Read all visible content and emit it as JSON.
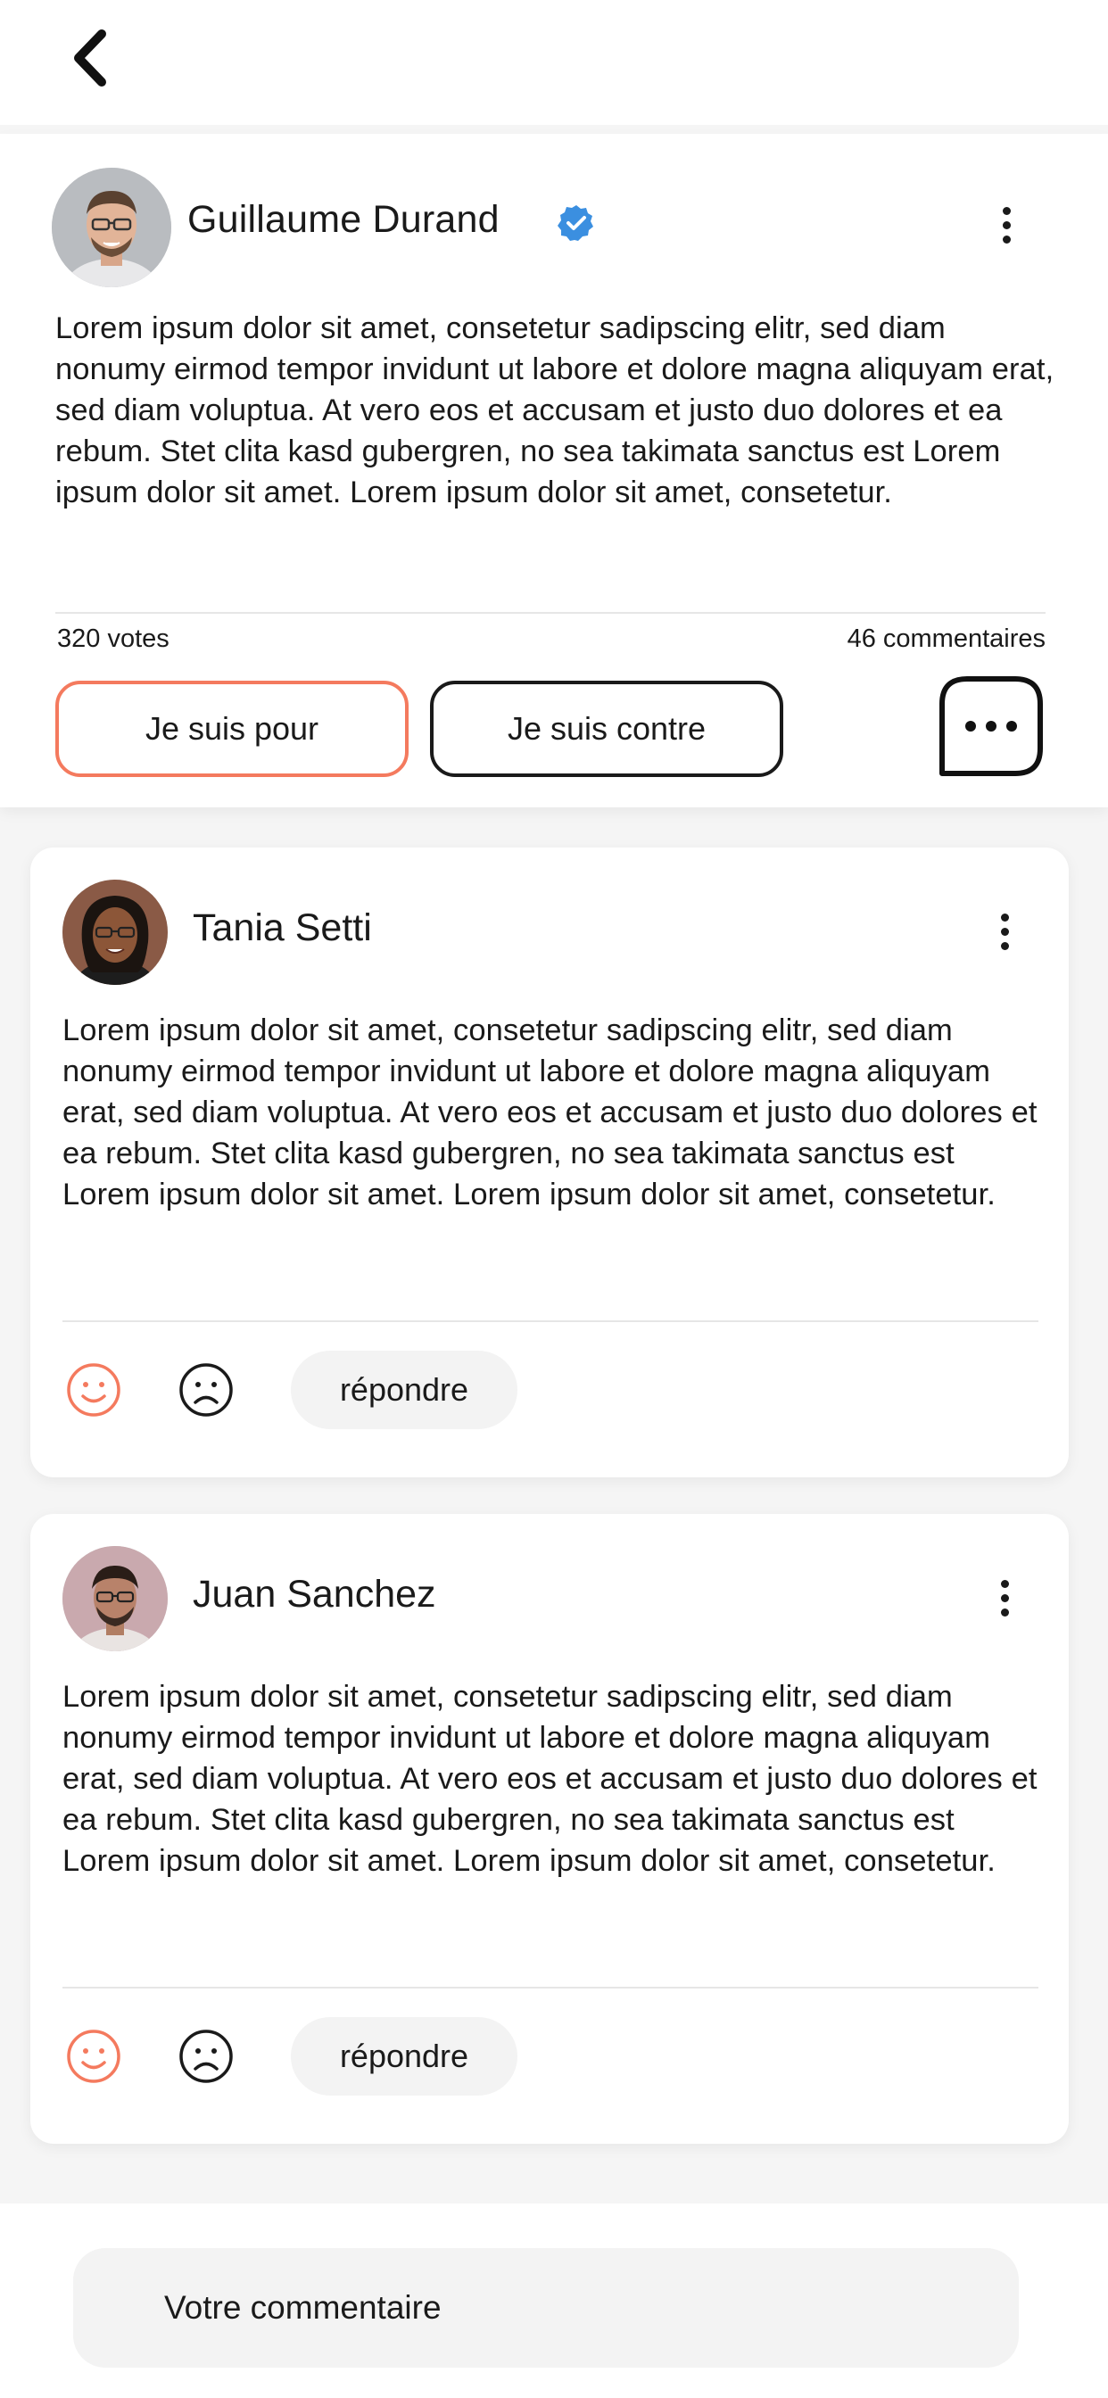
{
  "post": {
    "author": "Guillaume Durand",
    "verified": true,
    "text": "Lorem ipsum dolor sit amet, consetetur sadipscing elitr, sed diam nonumy eirmod tempor invidunt ut labore et dolore magna aliquyam erat, sed diam voluptua. At vero eos et accusam et justo duo dolores et ea rebum. Stet clita kasd gubergren, no sea takimata sanctus est Lorem ipsum dolor sit amet. Lorem ipsum dolor sit amet, consetetur.",
    "votes": "320 votes",
    "comments_count": "46 commentaires",
    "pour_label": "Je suis pour",
    "contre_label": "Je suis contre"
  },
  "comments": [
    {
      "author": "Tania Setti",
      "text": "Lorem ipsum dolor sit amet, consetetur sadipscing elitr, sed diam nonumy eirmod tempor invidunt ut labore et dolore magna aliquyam erat, sed diam voluptua. At vero eos et accusam et justo duo dolores et ea rebum. Stet clita kasd gubergren, no sea takimata sanctus est Lorem ipsum dolor sit amet. Lorem ipsum dolor sit amet, consetetur.",
      "reply_label": "répondre"
    },
    {
      "author": "Juan Sanchez",
      "text": "Lorem ipsum dolor sit amet, consetetur sadipscing elitr, sed diam nonumy eirmod tempor invidunt ut labore et dolore magna aliquyam erat, sed diam voluptua. At vero eos et accusam et justo duo dolores et ea rebum. Stet clita kasd gubergren, no sea takimata sanctus est Lorem ipsum dolor sit amet. Lorem ipsum dolor sit amet, consetetur.",
      "reply_label": "répondre"
    }
  ],
  "comment_input": {
    "placeholder": "Votre commentaire"
  },
  "icons": {
    "back": "chevron-left-icon",
    "verified": "verified-badge-icon",
    "more": "more-vertical-icon",
    "chat": "chat-bubble-icon",
    "like": "smile-icon",
    "dislike": "frown-icon"
  },
  "colors": {
    "accent": "#f47a5e",
    "verified": "#3b8fe0",
    "text": "#1a1a1a",
    "background": "#f5f5f5",
    "card": "#ffffff"
  }
}
